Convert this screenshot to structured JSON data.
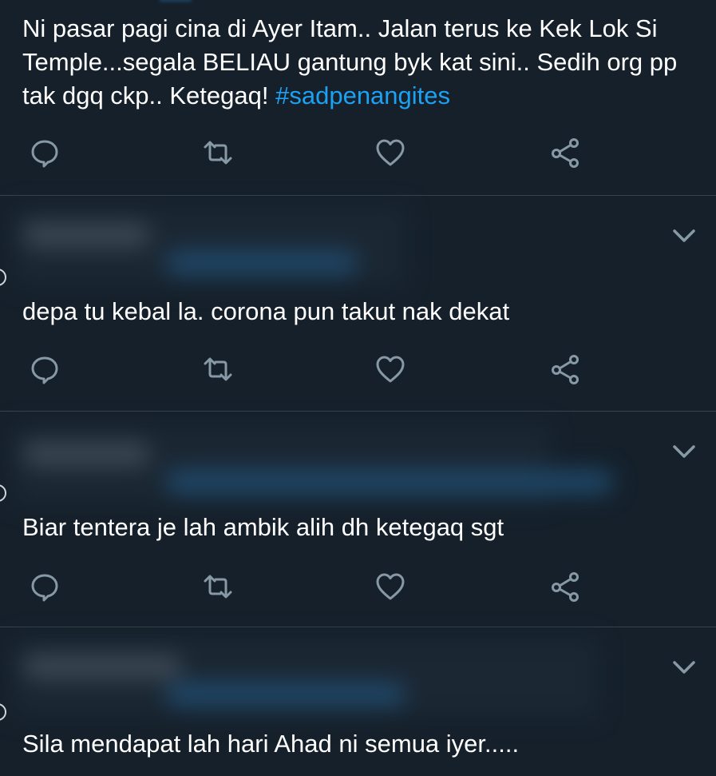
{
  "colors": {
    "background": "#15202b",
    "divider": "#38444d",
    "text": "#ffffff",
    "hashtag": "#1da1f2",
    "icon": "#8899a6"
  },
  "tweets": [
    {
      "text": "Ni pasar pagi cina di Ayer Itam.. Jalan terus ke Kek Lok Si Temple...segala BELIAU gantung byk kat sini.. Sedih org pp tak dgq ckp.. Ketegaq! ",
      "hashtag": "#sadpenangites",
      "actions": [
        "reply-icon",
        "retweet-icon",
        "like-icon",
        "share-icon"
      ]
    },
    {
      "author_blurred": true,
      "text": "depa tu kebal la. corona pun takut nak dekat",
      "actions": [
        "reply-icon",
        "retweet-icon",
        "like-icon",
        "share-icon"
      ]
    },
    {
      "author_blurred": true,
      "text": "Biar tentera je lah ambik alih dh ketegaq sgt",
      "actions": [
        "reply-icon",
        "retweet-icon",
        "like-icon",
        "share-icon"
      ]
    },
    {
      "author_blurred": true,
      "text": "Sila mendapat lah hari Ahad ni semua iyer....."
    }
  ]
}
